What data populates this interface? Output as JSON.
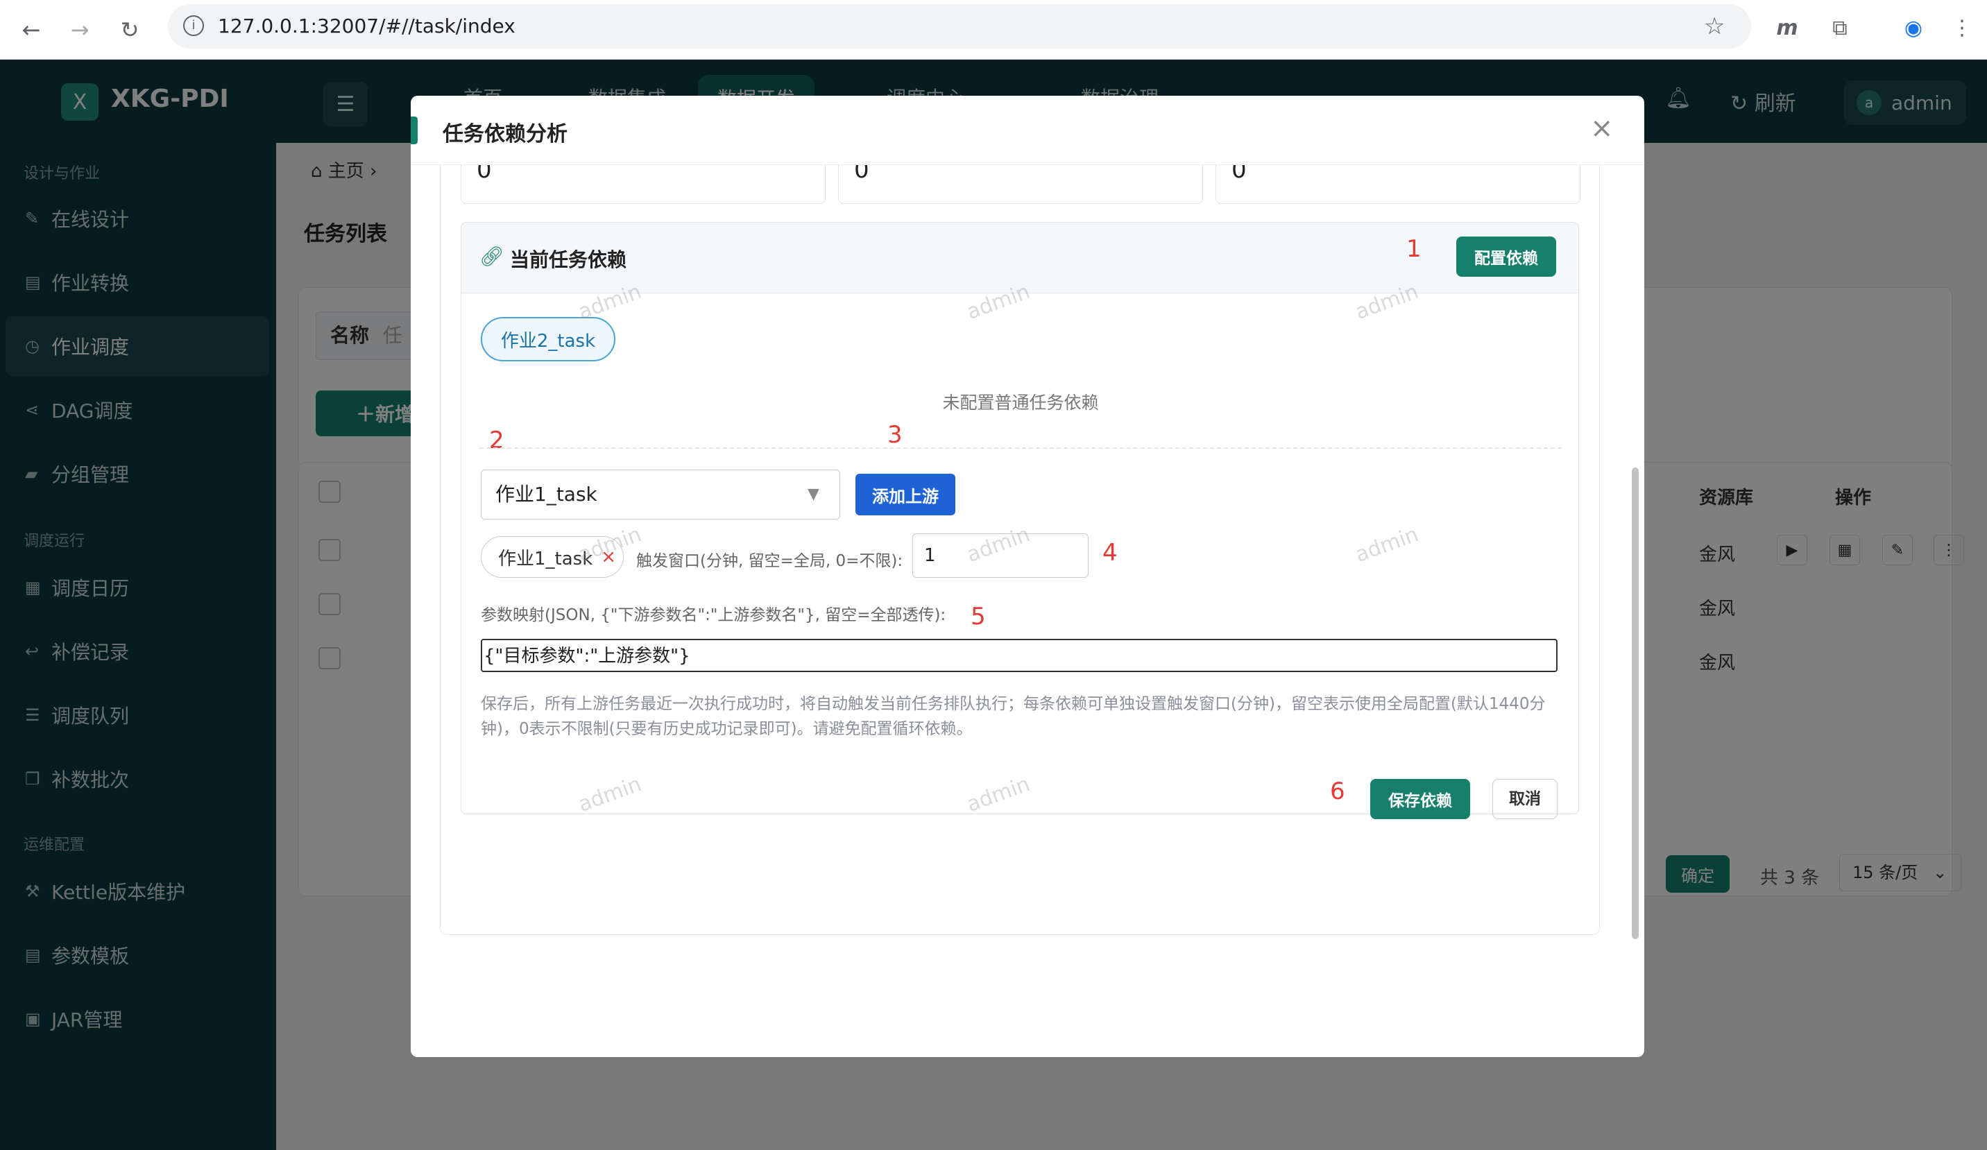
{
  "browser": {
    "url": "127.0.0.1:32007/#//task/index"
  },
  "app": {
    "logo_letter": "X",
    "name": "XKG-PDI",
    "top_tabs": [
      "首页",
      "数据集成",
      "数据开发",
      "调度中心",
      "数据治理"
    ],
    "refresh_label": "刷新",
    "user_initial": "a",
    "user_name": "admin"
  },
  "sidebar": {
    "sections": [
      {
        "title": "设计与作业",
        "items": [
          "在线设计",
          "作业转换",
          "作业调度",
          "DAG调度",
          "分组管理"
        ]
      },
      {
        "title": "调度运行",
        "items": [
          "调度日历",
          "补偿记录",
          "调度队列",
          "补数批次"
        ]
      },
      {
        "title": "运维配置",
        "items": [
          "Kettle版本维护",
          "参数模板",
          "JAR管理"
        ]
      }
    ],
    "active": "作业调度"
  },
  "page": {
    "breadcrumb_home": "主页",
    "title": "任务列表",
    "filter_label": "名称",
    "filter_placeholder": "任",
    "add_button": "新增",
    "col_resource": "资源库",
    "col_actions": "操作",
    "row_resource": "金风",
    "pager_confirm": "确定",
    "pager_total": "共 3 条",
    "pager_size": "15 条/页"
  },
  "modal": {
    "title": "任务依赖分析",
    "stats": [
      "0",
      "0",
      "0"
    ],
    "panel_title": "当前任务依赖",
    "config_button": "配置依赖",
    "current_chip": "作业2_task",
    "empty_text": "未配置普通任务依赖",
    "select_value": "作业1_task",
    "add_upstream_button": "添加上游",
    "upstream_chip": "作业1_task",
    "window_label": "触发窗口(分钟, 留空=全局, 0=不限):",
    "window_value": "1",
    "mapping_label": "参数映射(JSON, {\"下游参数名\":\"上游参数名\"}, 留空=全部透传):",
    "mapping_value": "{\"目标参数\":\"上游参数\"}",
    "help_text": "保存后，所有上游任务最近一次执行成功时，将自动触发当前任务排队执行；每条依赖可单独设置触发窗口(分钟)，留空表示使用全局配置(默认1440分钟)，0表示不限制(只要有历史成功记录即可)。请避免配置循环依赖。",
    "save_button": "保存依赖",
    "cancel_button": "取消",
    "annotations": [
      "1",
      "2",
      "3",
      "4",
      "5",
      "6"
    ],
    "watermark": "admin"
  },
  "colors": {
    "sidebar_bg": "#0b3a3d",
    "accent": "#17806d",
    "primary_blue": "#1e63d6",
    "annotation_red": "#e53935"
  }
}
